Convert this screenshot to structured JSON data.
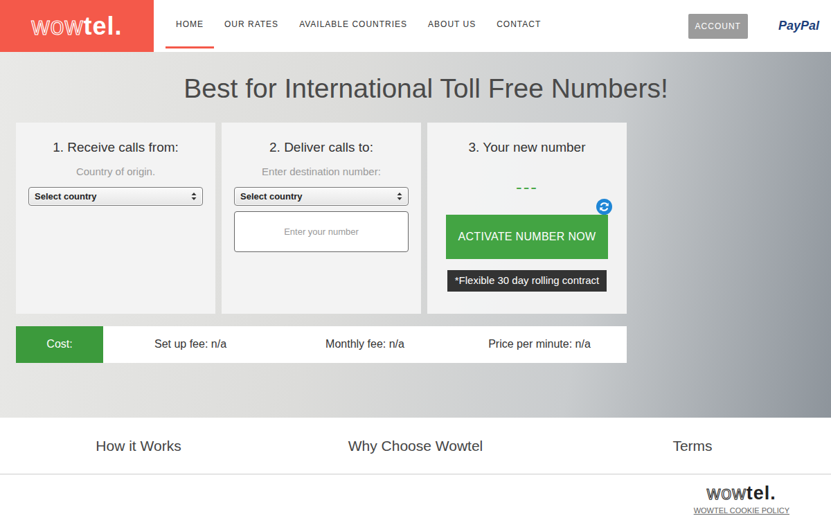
{
  "logo": {
    "light": "wow",
    "bold": "tel."
  },
  "nav": [
    {
      "label": "HOME",
      "selected": true
    },
    {
      "label": "OUR RATES",
      "selected": false
    },
    {
      "label": "AVAILABLE COUNTRIES",
      "selected": false
    },
    {
      "label": "ABOUT US",
      "selected": false
    },
    {
      "label": "CONTACT",
      "selected": false
    }
  ],
  "account": "ACCOUNT",
  "paypal": "PayPal",
  "hero": {
    "title": "Best for International Toll Free Numbers!"
  },
  "steps": [
    {
      "title": "1. Receive calls from:",
      "subtitle": "Country of origin.",
      "select": "Select country"
    },
    {
      "title": "2. Deliver calls to:",
      "subtitle": "Enter destination number:",
      "select": "Select country",
      "input_placeholder": "Enter your number"
    },
    {
      "title": "3. Your new number",
      "number": "---",
      "button": "ACTIVATE NUMBER NOW",
      "note": "*Flexible 30 day rolling contract"
    }
  ],
  "cost": {
    "label": "Cost:",
    "items": [
      "Set up fee: n/a",
      "Monthly fee: n/a",
      "Price per minute: n/a"
    ]
  },
  "links": [
    "How it Works",
    "Why Choose Wowtel",
    "Terms"
  ],
  "footer": {
    "logo": {
      "light": "wow",
      "bold": "tel."
    },
    "cookie": "WOWTEL COOKIE POLICY"
  }
}
